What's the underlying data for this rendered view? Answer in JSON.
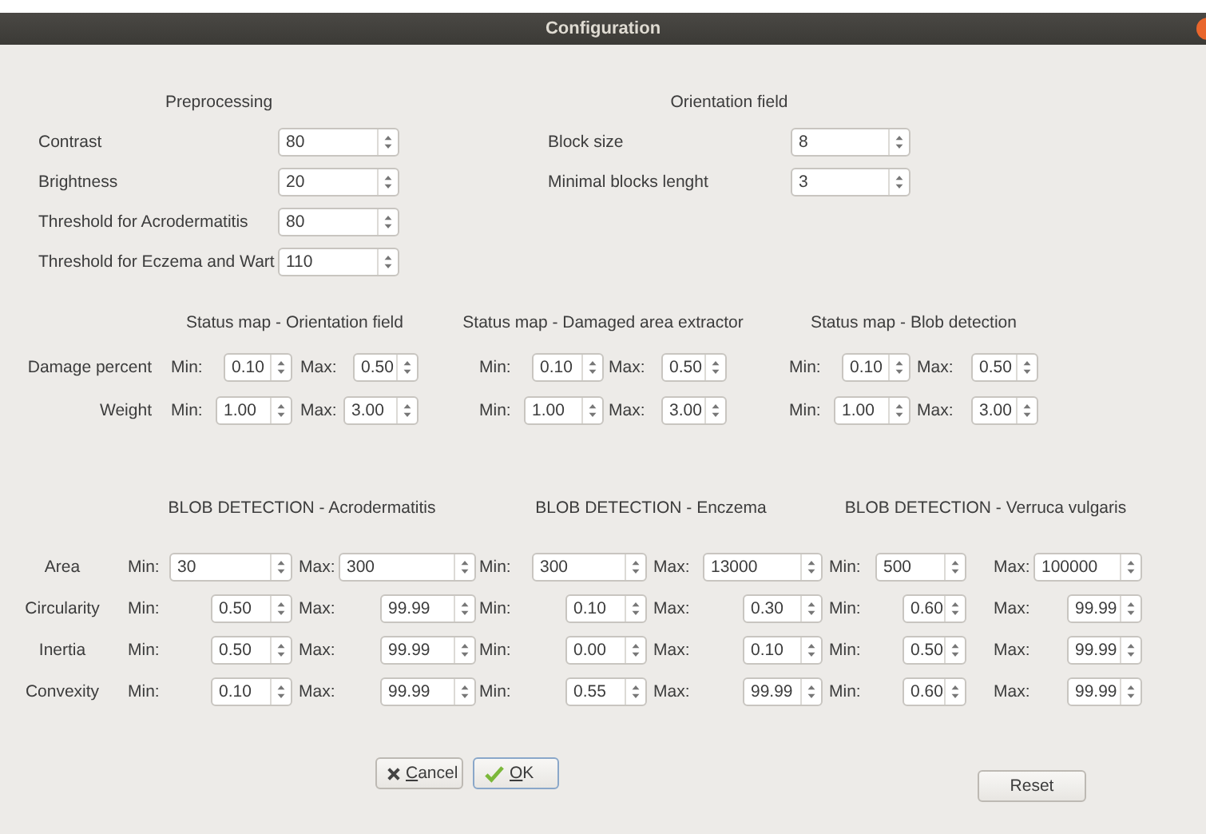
{
  "window": {
    "title": "Configuration"
  },
  "preprocessing": {
    "title": "Preprocessing",
    "fields": [
      {
        "label": "Contrast",
        "value": "80"
      },
      {
        "label": "Brightness",
        "value": "20"
      },
      {
        "label": "Threshold for Acrodermatitis",
        "value": "80"
      },
      {
        "label": "Threshold for Eczema and Wart",
        "value": "110"
      }
    ]
  },
  "orientation_field": {
    "title": "Orientation field",
    "fields": [
      {
        "label": "Block size",
        "value": "8"
      },
      {
        "label": "Minimal blocks lenght",
        "value": "3"
      }
    ]
  },
  "status_maps": {
    "row_labels": [
      "Damage percent",
      "Weight"
    ],
    "groups": [
      {
        "title": "Status map - Orientation field",
        "rows": [
          {
            "min_label": "Min:",
            "min": "0.10",
            "max_label": "Max:",
            "max": "0.50"
          },
          {
            "min_label": "Min:",
            "min": "1.00",
            "max_label": "Max:",
            "max": "3.00"
          }
        ]
      },
      {
        "title": "Status map - Damaged area extractor",
        "rows": [
          {
            "min_label": "Min:",
            "min": "0.10",
            "max_label": "Max:",
            "max": "0.50"
          },
          {
            "min_label": "Min:",
            "min": "1.00",
            "max_label": "Max:",
            "max": "3.00"
          }
        ]
      },
      {
        "title": "Status map - Blob detection",
        "rows": [
          {
            "min_label": "Min:",
            "min": "0.10",
            "max_label": "Max:",
            "max": "0.50"
          },
          {
            "min_label": "Min:",
            "min": "1.00",
            "max_label": "Max:",
            "max": "3.00"
          }
        ]
      }
    ]
  },
  "blob_detection": {
    "row_labels": [
      "Area",
      "Circularity",
      "Inertia",
      "Convexity"
    ],
    "groups": [
      {
        "title": "BLOB DETECTION - Acrodermatitis",
        "rows": [
          {
            "min_label": "Min:",
            "min": "30",
            "max_label": "Max:",
            "max": "300"
          },
          {
            "min_label": "Min:",
            "min": "0.50",
            "max_label": "Max:",
            "max": "99.99"
          },
          {
            "min_label": "Min:",
            "min": "0.50",
            "max_label": "Max:",
            "max": "99.99"
          },
          {
            "min_label": "Min:",
            "min": "0.10",
            "max_label": "Max:",
            "max": "99.99"
          }
        ]
      },
      {
        "title": "BLOB DETECTION - Enczema",
        "rows": [
          {
            "min_label": "Min:",
            "min": "300",
            "max_label": "Max:",
            "max": "13000"
          },
          {
            "min_label": "Min:",
            "min": "0.10",
            "max_label": "Max:",
            "max": "0.30"
          },
          {
            "min_label": "Min:",
            "min": "0.00",
            "max_label": "Max:",
            "max": "0.10"
          },
          {
            "min_label": "Min:",
            "min": "0.55",
            "max_label": "Max:",
            "max": "99.99"
          }
        ]
      },
      {
        "title": "BLOB DETECTION - Verruca vulgaris",
        "rows": [
          {
            "min_label": "Min:",
            "min": "500",
            "max_label": "Max:",
            "max": "100000"
          },
          {
            "min_label": "Min:",
            "min": "0.60",
            "max_label": "Max:",
            "max": "99.99"
          },
          {
            "min_label": "Min:",
            "min": "0.50",
            "max_label": "Max:",
            "max": "99.99"
          },
          {
            "min_label": "Min:",
            "min": "0.60",
            "max_label": "Max:",
            "max": "99.99"
          }
        ]
      }
    ]
  },
  "buttons": [
    {
      "label": "Cancel",
      "kind": "cancel",
      "underline_first": true
    },
    {
      "label": "OK",
      "kind": "ok",
      "underline_first": true
    },
    {
      "label": "Reset",
      "kind": "reset"
    }
  ]
}
